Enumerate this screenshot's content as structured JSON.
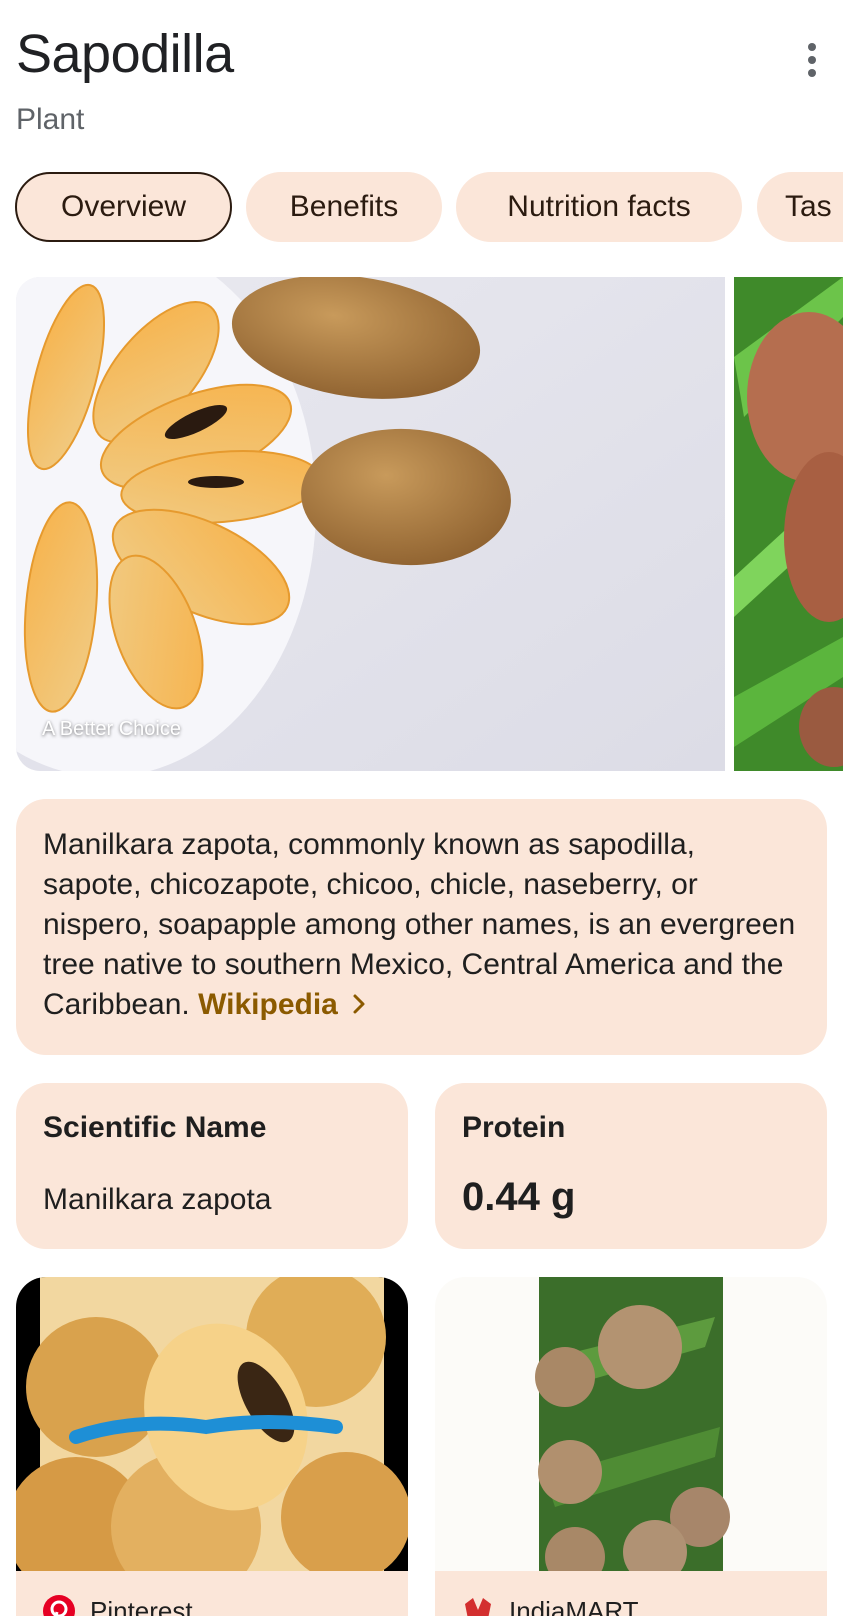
{
  "header": {
    "title": "Sapodilla",
    "subtitle": "Plant",
    "more_icon": "more-vert-icon"
  },
  "tabs": [
    {
      "label": "Overview",
      "active": true
    },
    {
      "label": "Benefits",
      "active": false
    },
    {
      "label": "Nutrition facts",
      "active": false
    },
    {
      "label": "Tas",
      "active": false
    }
  ],
  "hero": {
    "caption": "A Better Choice"
  },
  "description": {
    "text": "Manilkara zapota, commonly known as sapodilla, sapote, chicozapote, chicoo, chicle, naseberry, or nispero, soapapple among other names, is an evergreen tree native to southern Mexico, Central America and the Caribbean.",
    "link_label": "Wikipedia",
    "link_icon": "chevron-right-icon"
  },
  "facts": [
    {
      "label": "Scientific Name",
      "value": "Manilkara zapota"
    },
    {
      "label": "Protein",
      "value": "0.44 g"
    }
  ],
  "results": [
    {
      "source": "Pinterest",
      "icon": "pinterest-icon"
    },
    {
      "source": "IndiaMART",
      "icon": "indiamart-icon"
    }
  ],
  "colors": {
    "chip_bg": "#fbe6d9",
    "card_bg": "#fbe6d9",
    "link": "#8b5a00",
    "text": "#1f1f1f"
  }
}
